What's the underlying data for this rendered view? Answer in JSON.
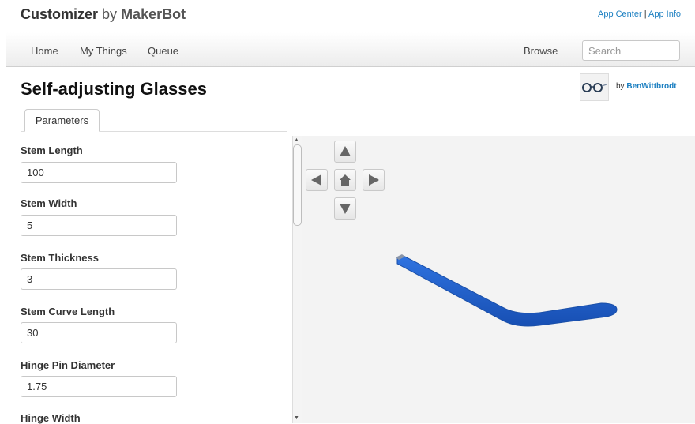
{
  "header": {
    "app_name": "Customizer",
    "by": "by",
    "brand": "MakerBot",
    "links": [
      "App Center",
      "App Info"
    ],
    "link_separator": "|"
  },
  "nav": {
    "items": [
      "Home",
      "My Things",
      "Queue"
    ],
    "browse": "Browse",
    "search_placeholder": "Search"
  },
  "page": {
    "title": "Self-adjusting Glasses",
    "author_by": "by",
    "author": "BenWittbrodt"
  },
  "tabs": [
    {
      "label": "Parameters",
      "active": true
    }
  ],
  "parameters": [
    {
      "label": "Stem Length",
      "value": "100"
    },
    {
      "label": "Stem Width",
      "value": "5"
    },
    {
      "label": "Stem Thickness",
      "value": "3"
    },
    {
      "label": "Stem Curve Length",
      "value": "30"
    },
    {
      "label": "Hinge Pin Diameter",
      "value": "1.75"
    },
    {
      "label": "Hinge Width",
      "value": ""
    }
  ],
  "viewer": {
    "controls": [
      "up-arrow-icon",
      "left-arrow-icon",
      "home-icon",
      "right-arrow-icon",
      "down-arrow-icon"
    ],
    "model_color": "#1f5fc9",
    "background_color": "#f3f3f3"
  },
  "colors": {
    "link": "#1b7fc1",
    "title": "#111111"
  }
}
